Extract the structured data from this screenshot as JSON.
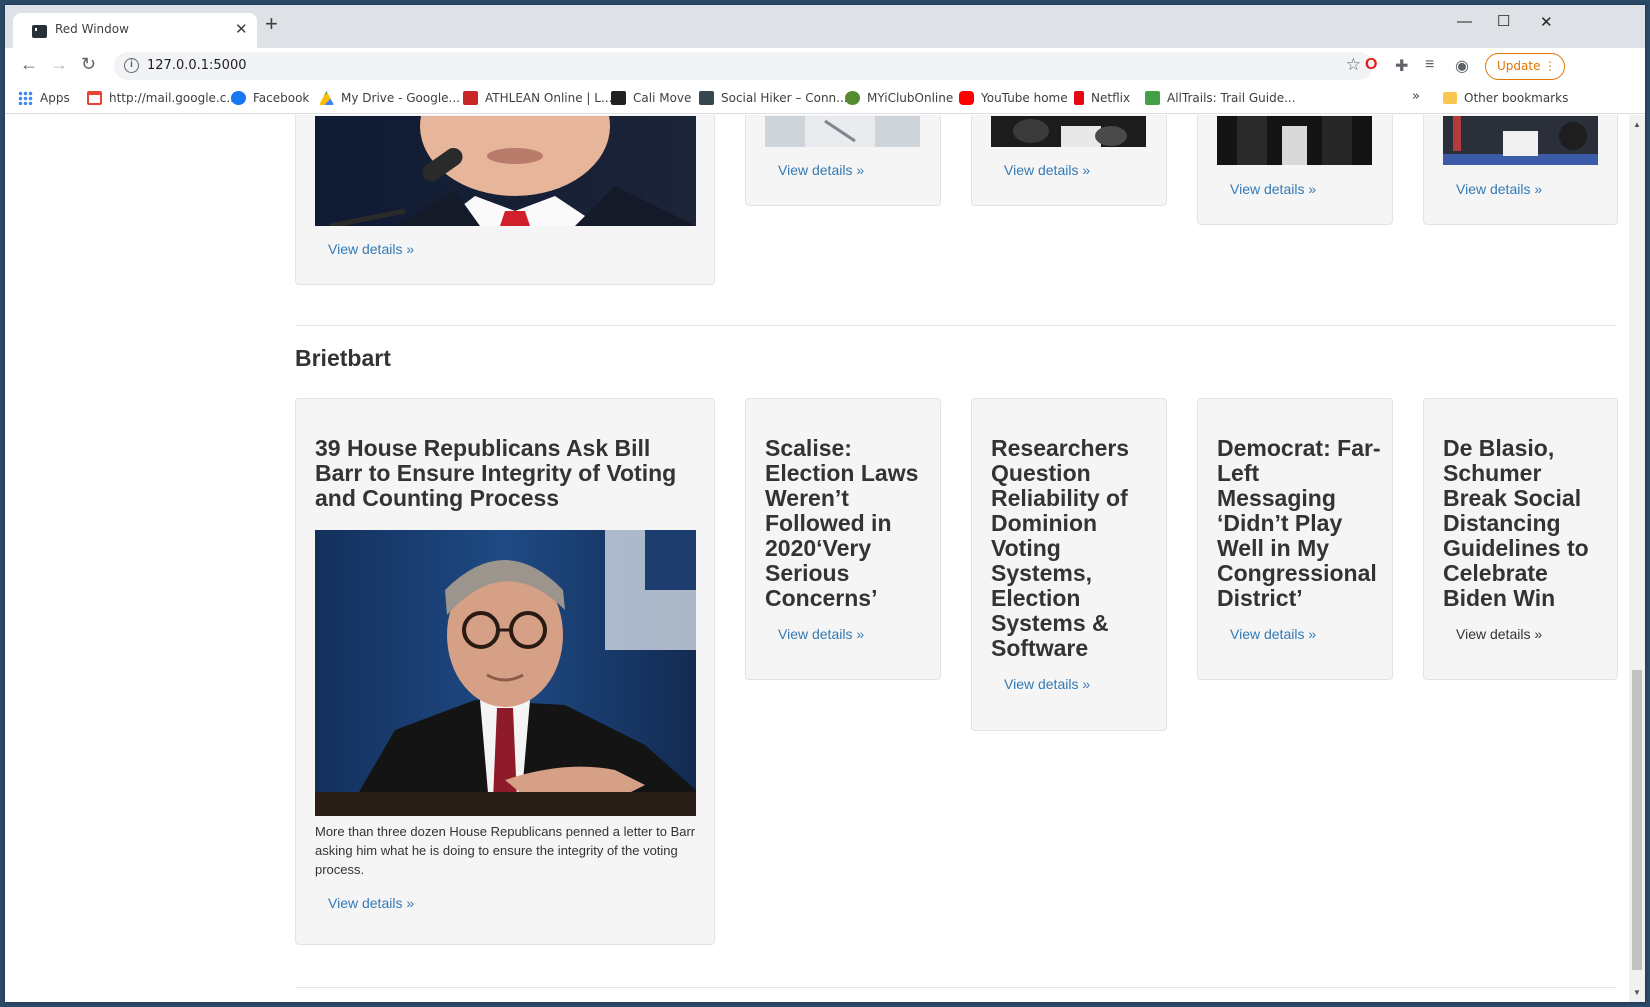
{
  "browser": {
    "tab_title": "Red Window",
    "url": "127.0.0.1:5000",
    "update_label": "Update",
    "bookmarks": [
      {
        "label": "Apps",
        "color": "#4285f4"
      },
      {
        "label": "http://mail.google.c...",
        "color": "#ea4335"
      },
      {
        "label": "Facebook",
        "color": "#1877f2"
      },
      {
        "label": "My Drive - Google...",
        "color": "#fbbc04"
      },
      {
        "label": "ATHLEAN Online | L...",
        "color": "#c62828"
      },
      {
        "label": "Cali Move",
        "color": "#212121"
      },
      {
        "label": "Social Hiker – Conn...",
        "color": "#37474f"
      },
      {
        "label": "MYiClubOnline",
        "color": "#558b2f"
      },
      {
        "label": "YouTube home",
        "color": "#ff0000"
      },
      {
        "label": "Netflix",
        "color": "#e50914"
      },
      {
        "label": "AllTrails: Trail Guide...",
        "color": "#43a047"
      }
    ],
    "other_bookmarks": "Other bookmarks",
    "more_bookmarks": "»"
  },
  "top_section": {
    "cards": [
      {
        "link": "View details »"
      },
      {
        "link": "View details »"
      },
      {
        "link": "View details »"
      },
      {
        "link": "View details »"
      },
      {
        "link": "View details »"
      }
    ]
  },
  "breitbart": {
    "section_title": "Brietbart",
    "cards": [
      {
        "title": "39 House Republicans Ask Bill Barr to Ensure Integrity of Voting and Counting Process",
        "description": "More than three dozen House Republicans penned a letter to Barr asking him what he is doing to ensure the integrity of the voting process.",
        "link": "View details »"
      },
      {
        "title": "Scalise: Election Laws Weren’t Followed in 2020‘Very Serious Concerns’",
        "link": "View details »"
      },
      {
        "title": "Researchers Question Reliability of Dominion Voting Systems, Election Systems & Software",
        "link": "View details »"
      },
      {
        "title": "Democrat: Far-Left Messaging ‘Didn’t Play Well in My Congressional District’",
        "link": "View details »"
      },
      {
        "title": "De Blasio, Schumer Break Social Distancing Guidelines to Celebrate Biden Win",
        "link": "View details »"
      }
    ]
  },
  "colors": {
    "link": "#337ab7",
    "card_bg": "#f5f5f5",
    "update_accent": "#e37400"
  }
}
